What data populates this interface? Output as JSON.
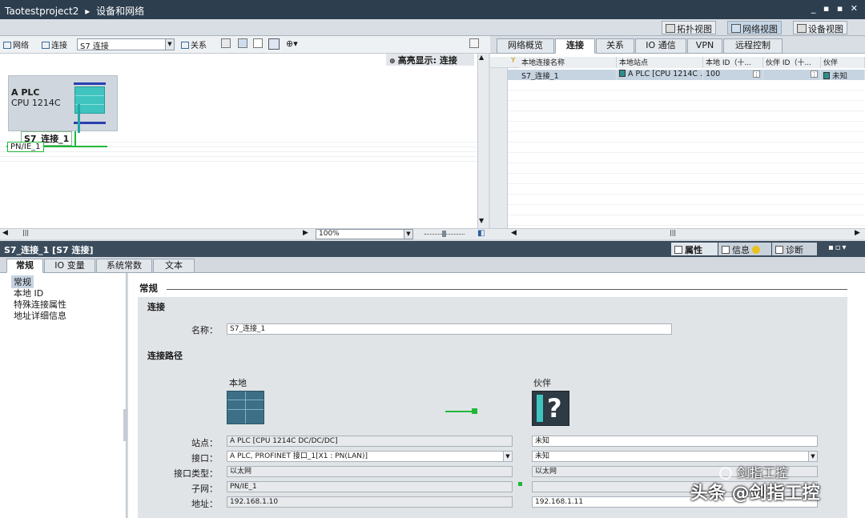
{
  "titlebar": {
    "project": "Taotestproject2",
    "separator": "▸",
    "section": "设备和网络",
    "controls": "_ ▪ ▪ ✕"
  },
  "views": {
    "topology": "拓扑视图",
    "network": "网络视图",
    "device": "设备视图"
  },
  "left_toolbar": {
    "network_btn": "网络",
    "connect_btn": "连接",
    "connect_type": "S7 连接",
    "relation_btn": "关系"
  },
  "canvas": {
    "highlight": "高亮显示: 连接",
    "plc_name": "A PLC",
    "plc_model": "CPU 1214C",
    "connection_label": "S7_连接_1",
    "subnet_label": "PN/IE_1"
  },
  "zoom": {
    "value": "100%"
  },
  "right_tabs": [
    "网络概览",
    "连接",
    "关系",
    "IO 通信",
    "VPN",
    "远程控制"
  ],
  "table": {
    "headers": [
      "本地连接名称",
      "本地站点",
      "本地 ID（十...",
      "伙伴 ID（十...",
      "伙伴"
    ],
    "rows": [
      {
        "name": "S7_连接_1",
        "station": "A PLC [CPU 1214C ...",
        "local_id": "100",
        "partner_id": "",
        "partner": "未知"
      }
    ]
  },
  "properties_bar": {
    "title": "S7_连接_1 [S7 连接]",
    "tabs": {
      "properties": "属性",
      "info": "信息",
      "diagnostics": "诊断"
    }
  },
  "prop_tabs": [
    "常规",
    "IO 变量",
    "系统常数",
    "文本"
  ],
  "nav_items": [
    "常规",
    "本地 ID",
    "特殊连接属性",
    "地址详细信息"
  ],
  "general": {
    "header": "常规",
    "connection_section": "连接",
    "name_label": "名称：",
    "name_value": "S7_连接_1",
    "path_section": "连接路径",
    "local_label": "本地",
    "partner_label": "伙伴",
    "station_label": "站点：",
    "interface_label": "接口：",
    "interface_type_label": "接口类型：",
    "subnet_label": "子网：",
    "address_label": "地址：",
    "local_station": "A PLC [CPU 1214C DC/DC/DC]",
    "local_interface": "A PLC, PROFINET 接口_1[X1 : PN(LAN)]",
    "local_interface_type": "以太网",
    "local_subnet": "PN/IE_1",
    "local_address": "192.168.1.10",
    "partner_station": "未知",
    "partner_interface": "未知",
    "partner_interface_type": "以太网",
    "partner_subnet": "",
    "partner_address": "192.168.1.11"
  },
  "watermark": {
    "logo_text": "剑指工控",
    "caption": "头条 @剑指工控"
  },
  "colors": {
    "title_bg": "#2d3e4f",
    "accent_blue": "#2a3fb0",
    "plc_teal": "#3fc4c0",
    "link_green": "#1fb83a"
  }
}
